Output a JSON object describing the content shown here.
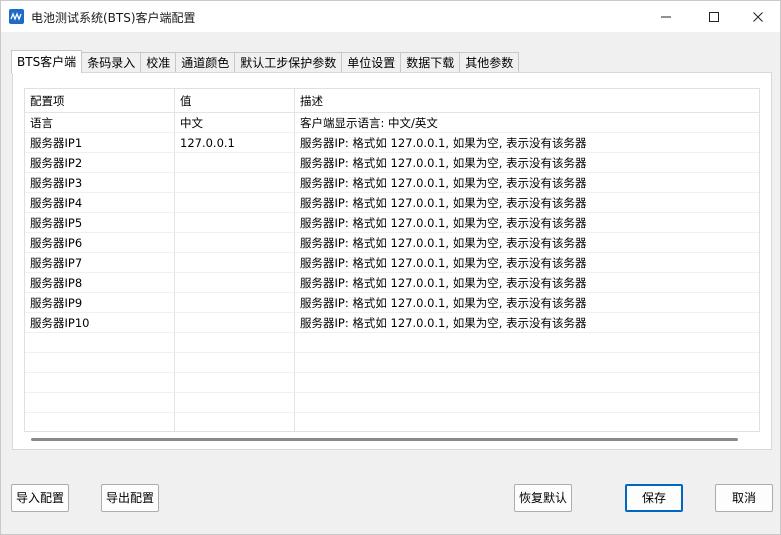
{
  "window": {
    "title": "电池测试系统(BTS)客户端配置",
    "controls": [
      "minimize-icon",
      "maximize-icon",
      "close-icon"
    ]
  },
  "tabs": [
    {
      "label": "BTS客户端",
      "active": true
    },
    {
      "label": "条码录入",
      "active": false
    },
    {
      "label": "校准",
      "active": false
    },
    {
      "label": "通道颜色",
      "active": false
    },
    {
      "label": "默认工步保护参数",
      "active": false
    },
    {
      "label": "单位设置",
      "active": false
    },
    {
      "label": "数据下载",
      "active": false
    },
    {
      "label": "其他参数",
      "active": false
    }
  ],
  "table": {
    "columns": [
      "配置项",
      "值",
      "描述"
    ],
    "rows": [
      [
        "语言",
        "中文",
        "客户端显示语言: 中文/英文"
      ],
      [
        "服务器IP1",
        "127.0.0.1",
        "服务器IP: 格式如 127.0.0.1, 如果为空, 表示没有该务器"
      ],
      [
        "服务器IP2",
        "",
        "服务器IP: 格式如 127.0.0.1, 如果为空, 表示没有该务器"
      ],
      [
        "服务器IP3",
        "",
        "服务器IP: 格式如 127.0.0.1, 如果为空, 表示没有该务器"
      ],
      [
        "服务器IP4",
        "",
        "服务器IP: 格式如 127.0.0.1, 如果为空, 表示没有该务器"
      ],
      [
        "服务器IP5",
        "",
        "服务器IP: 格式如 127.0.0.1, 如果为空, 表示没有该务器"
      ],
      [
        "服务器IP6",
        "",
        "服务器IP: 格式如 127.0.0.1, 如果为空, 表示没有该务器"
      ],
      [
        "服务器IP7",
        "",
        "服务器IP: 格式如 127.0.0.1, 如果为空, 表示没有该务器"
      ],
      [
        "服务器IP8",
        "",
        "服务器IP: 格式如 127.0.0.1, 如果为空, 表示没有该务器"
      ],
      [
        "服务器IP9",
        "",
        "服务器IP: 格式如 127.0.0.1, 如果为空, 表示没有该务器"
      ],
      [
        "服务器IP10",
        "",
        "服务器IP: 格式如 127.0.0.1, 如果为空, 表示没有该务器"
      ],
      [
        "",
        "",
        ""
      ],
      [
        "",
        "",
        ""
      ],
      [
        "",
        "",
        ""
      ],
      [
        "",
        "",
        ""
      ],
      [
        "",
        "",
        ""
      ]
    ]
  },
  "buttons": {
    "import": "导入配置",
    "export": "导出配置",
    "restore_default": "恢复默认",
    "save": "保存",
    "cancel": "取消"
  },
  "colors": {
    "title_bg": "#ffffff",
    "window_bg": "#f0f0f0",
    "accent": "#0067c0",
    "app_icon": "#1e6cc8"
  }
}
